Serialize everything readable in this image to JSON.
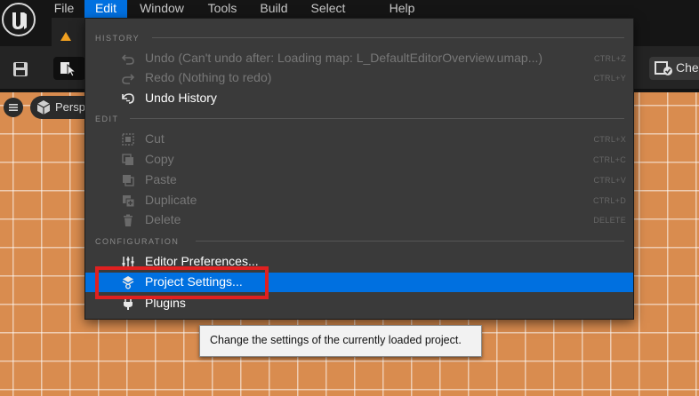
{
  "app": {
    "name": "Unreal Editor",
    "logo_icon": "unreal-engine-logo-icon"
  },
  "menubar": {
    "items": [
      {
        "label": "File",
        "active": false
      },
      {
        "label": "Edit",
        "active": true
      },
      {
        "label": "Window",
        "active": false
      },
      {
        "label": "Tools",
        "active": false
      },
      {
        "label": "Build",
        "active": false
      },
      {
        "label": "Select",
        "active": false
      },
      {
        "label": "Help",
        "active": false
      }
    ]
  },
  "toolbar": {
    "save_icon": "save-icon",
    "select_icon": "select-mode-icon",
    "checkout_label": "Che",
    "checkout_icon": "checkout-icon"
  },
  "viewport": {
    "view_mode_label": "Persp",
    "menu_icon": "hamburger-icon",
    "view_icon": "cube-icon"
  },
  "edit_menu": {
    "sections": [
      {
        "header": "HISTORY",
        "items": [
          {
            "label": "Undo (Can't undo after: Loading map: L_DefaultEditorOverview.umap...)",
            "shortcut": "CTRL+Z",
            "enabled": false,
            "icon": "undo-icon"
          },
          {
            "label": "Redo (Nothing to redo)",
            "shortcut": "CTRL+Y",
            "enabled": false,
            "icon": "redo-icon"
          },
          {
            "label": "Undo History",
            "shortcut": "",
            "enabled": true,
            "icon": "undo-history-icon"
          }
        ]
      },
      {
        "header": "EDIT",
        "items": [
          {
            "label": "Cut",
            "shortcut": "CTRL+X",
            "enabled": false,
            "icon": "cut-icon"
          },
          {
            "label": "Copy",
            "shortcut": "CTRL+C",
            "enabled": false,
            "icon": "copy-icon"
          },
          {
            "label": "Paste",
            "shortcut": "CTRL+V",
            "enabled": false,
            "icon": "paste-icon"
          },
          {
            "label": "Duplicate",
            "shortcut": "CTRL+D",
            "enabled": false,
            "icon": "duplicate-icon"
          },
          {
            "label": "Delete",
            "shortcut": "DELETE",
            "enabled": false,
            "icon": "delete-icon"
          }
        ]
      },
      {
        "header": "CONFIGURATION",
        "items": [
          {
            "label": "Editor Preferences...",
            "shortcut": "",
            "enabled": true,
            "icon": "editor-preferences-icon"
          },
          {
            "label": "Project Settings...",
            "shortcut": "",
            "enabled": true,
            "icon": "project-settings-icon",
            "highlighted": true
          },
          {
            "label": "Plugins",
            "shortcut": "",
            "enabled": true,
            "icon": "plugins-icon"
          }
        ]
      }
    ]
  },
  "tooltip": {
    "text": "Change the settings of the currently loaded project."
  },
  "colors": {
    "accent": "#0070e0",
    "annotation": "#e02020",
    "viewport_floor": "#d98c4f",
    "menu_bg": "#3a3a3a"
  }
}
